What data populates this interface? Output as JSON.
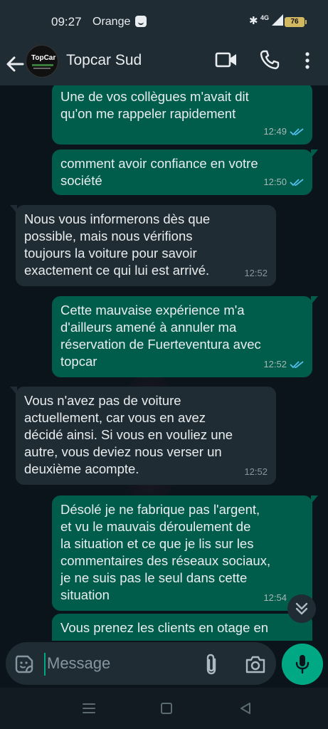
{
  "status_bar": {
    "time": "09:27",
    "carrier": "Orange",
    "network": "4G",
    "battery": "76"
  },
  "header": {
    "contact_name": "Topcar Sud",
    "avatar_text": "TopCar"
  },
  "messages": [
    {
      "direction": "out",
      "text": "Une de vos collègues m'avait dit\nqu'on me rappeler rapidement",
      "time": "12:49",
      "read": true
    },
    {
      "direction": "out",
      "text": "comment avoir confiance en votre\nsociété",
      "time": "12:50",
      "read": true
    },
    {
      "direction": "in",
      "text": "Nous vous informerons dès que\npossible, mais nous vérifions\ntoujours la voiture pour savoir\nexactement ce qui lui est arrivé.",
      "time": "12:52"
    },
    {
      "direction": "out",
      "text": "Cette mauvaise expérience m'a\nd'ailleurs amené à annuler ma\nréservation de Fuerteventura avec\ntopcar",
      "time": "12:52",
      "read": true
    },
    {
      "direction": "in",
      "text": "Vous n'avez pas de voiture\nactuellement, car vous en avez\ndécidé ainsi. Si vous en vouliez une\nautre, vous deviez nous verser un\ndeuxième acompte.",
      "time": "12:52"
    },
    {
      "direction": "out",
      "text": "Désolé je ne fabrique pas l'argent,\net vu le mauvais déroulement de\nla situation et ce que je lis sur les\ncommentaires des réseaux sociaux,\nje ne suis pas le seul dans cette\nsituation",
      "time": "12:54"
    },
    {
      "direction": "out",
      "text": "Vous prenez les clients en otage en",
      "time": ""
    }
  ],
  "composer": {
    "placeholder": "Message"
  },
  "colors": {
    "background": "#0b141a",
    "header": "#1f2c34",
    "outgoing_bubble": "#005c4b",
    "incoming_bubble": "#202c33",
    "accent": "#00a884",
    "read_ticks": "#53bdeb"
  },
  "icons": {
    "back": "arrow-left-icon",
    "video": "video-camera-icon",
    "call": "phone-icon",
    "menu": "more-vertical-icon",
    "sticker": "sticker-icon",
    "attach": "paperclip-icon",
    "camera": "camera-icon",
    "mic": "microphone-icon",
    "scroll": "double-chevron-down-icon"
  }
}
